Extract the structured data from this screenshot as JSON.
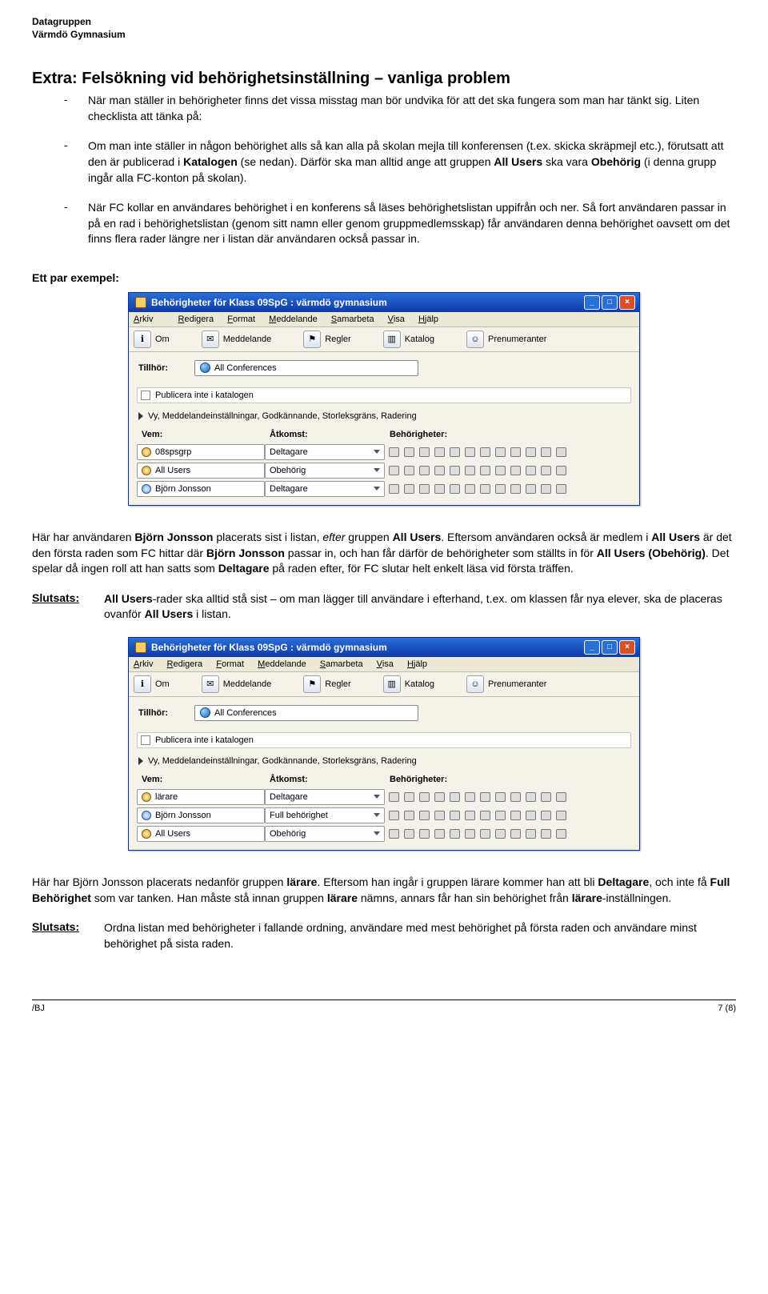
{
  "org": {
    "line1": "Datagruppen",
    "line2": "Värmdö Gymnasium"
  },
  "title": "Extra: Felsökning vid behörighetsinställning – vanliga problem",
  "intro": {
    "bullet1": "När man ställer in behörigheter finns det vissa misstag man bör undvika för att det ska fungera som man har tänkt sig. Liten checklista att tänka på:",
    "bullet2a": "Om man inte ställer in någon behörighet alls så kan alla på skolan mejla till konferensen (t.ex. skicka skräpmejl etc.), förutsatt att den är publicerad i ",
    "bullet2b": " (se nedan). Därför ska man alltid ange att gruppen ",
    "bullet2c": " ska vara ",
    "bullet2d": " (i denna grupp ingår alla FC-konton på skolan).",
    "bullet3": "När FC kollar en användares behörighet i en konferens så läses behörighetslistan uppifrån och ner. Så fort användaren passar in på en rad i behörighetslistan (genom sitt namn eller genom gruppmedlemsskap) får användaren denna behörighet oavsett om det finns flera rader längre ner i listan där användaren också passar in.",
    "bold_katalogen": "Katalogen",
    "bold_allusers": "All Users",
    "bold_obehorig": "Obehörig",
    "example_label": "Ett par exempel:"
  },
  "win": {
    "title": "Behörigheter för Klass 09SpG : värmdö gymnasium",
    "menu": {
      "arkiv": "Arkiv",
      "redigera": "Redigera",
      "format": "Format",
      "meddelande": "Meddelande",
      "samarbeta": "Samarbeta",
      "visa": "Visa",
      "hjalp": "Hjälp"
    },
    "tb": {
      "om": "Om",
      "medd": "Meddelande",
      "regler": "Regler",
      "katalog": "Katalog",
      "pren": "Prenumeranter"
    },
    "tillhor": "Tillhör:",
    "allconf": "All Conferences",
    "pub": "Publicera inte i katalogen",
    "expand": "Vy, Meddelandeinställningar, Godkännande, Storleksgräns, Radering",
    "head": {
      "vem": "Vem:",
      "atk": "Åtkomst:",
      "beh": "Behörigheter:"
    }
  },
  "grid1": [
    {
      "who": "08spsgrp",
      "icon": "gold",
      "atk": "Deltagare"
    },
    {
      "who": "All Users",
      "icon": "gold",
      "atk": "Obehörig"
    },
    {
      "who": "Björn Jonsson",
      "icon": "person",
      "atk": "Deltagare"
    }
  ],
  "para1a": "Här har användaren ",
  "para1b": " placerats sist i listan, ",
  "para1c": " gruppen ",
  "para1d": ". Eftersom användaren också är medlem i ",
  "para1e": " är det den första raden som FC hittar där ",
  "para1f": " passar in, och han får därför de behörigheter som ställts in för ",
  "para1g": ". Det spelar då ingen roll att han satts som ",
  "para1h": " på raden efter, för FC slutar helt enkelt läsa vid första träffen.",
  "bold": {
    "bjorn": "Björn Jonsson",
    "efter": "efter",
    "allusers": "All Users",
    "allusers_obe": "All Users (Obehörig)",
    "deltagare": "Deltagare"
  },
  "slutsats_label": "Slutsats:",
  "slutsats1a": "All Users",
  "slutsats1b": "-rader ska alltid stå sist – om man lägger till användare i efterhand, t.ex. om klassen får nya elever, ska de placeras ovanför ",
  "slutsats1c": " i listan.",
  "grid2": [
    {
      "who": "lärare",
      "icon": "gold",
      "atk": "Deltagare"
    },
    {
      "who": "Björn Jonsson",
      "icon": "person",
      "atk": "Full behörighet"
    },
    {
      "who": "All Users",
      "icon": "gold",
      "atk": "Obehörig"
    }
  ],
  "para2a": "Här har Björn Jonsson placerats nedanför gruppen ",
  "para2b": ". Eftersom han ingår i gruppen lärare kommer han att bli ",
  "para2c": ", och inte få ",
  "para2d": " som var tanken. Han måste stå innan gruppen ",
  "para2e": " nämns, annars får han sin behörighet från ",
  "para2f": "-inställningen.",
  "bold2": {
    "larare": "lärare",
    "deltagare": "Deltagare",
    "full": "Full Behörighet"
  },
  "slutsats2": "Ordna listan med behörigheter i fallande ordning, användare med mest behörighet på första raden och användare minst behörighet på sista raden.",
  "footer": {
    "left": "/BJ",
    "right": "7 (8)"
  }
}
